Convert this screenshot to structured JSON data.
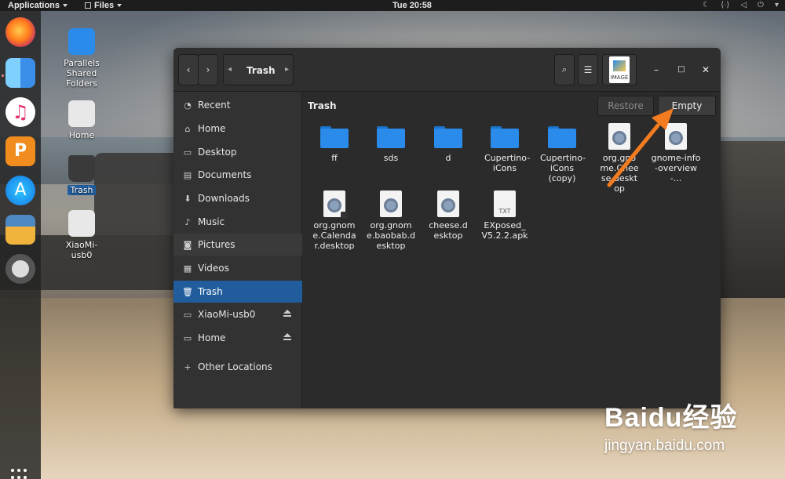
{
  "topbar": {
    "applications_label": "Applications",
    "files_label": "Files",
    "clock": "Tue 20:58"
  },
  "dock": {
    "items": [
      "firefox-icon",
      "finder-icon",
      "music-icon",
      "presentation-icon",
      "app-store-icon",
      "installer-icon",
      "lifebuoy-icon"
    ]
  },
  "desktop": {
    "icons": [
      {
        "label": "Parallels Shared Folders"
      },
      {
        "label": "Home"
      },
      {
        "label": "Trash"
      },
      {
        "label": "XiaoMi-usb0"
      }
    ]
  },
  "window": {
    "breadcrumb": "Trash",
    "view_thumb_label": "IMAGE"
  },
  "sidebar": {
    "items": [
      {
        "label": "Recent",
        "icon": "clock-icon"
      },
      {
        "label": "Home",
        "icon": "home-icon"
      },
      {
        "label": "Desktop",
        "icon": "desktop-icon"
      },
      {
        "label": "Documents",
        "icon": "document-icon"
      },
      {
        "label": "Downloads",
        "icon": "download-icon"
      },
      {
        "label": "Music",
        "icon": "music-note-icon"
      },
      {
        "label": "Pictures",
        "icon": "camera-icon"
      },
      {
        "label": "Videos",
        "icon": "film-icon"
      },
      {
        "label": "Trash",
        "icon": "trash-icon"
      },
      {
        "label": "XiaoMi-usb0",
        "icon": "drive-icon"
      },
      {
        "label": "Home",
        "icon": "drive-icon"
      },
      {
        "label": "Other Locations",
        "icon": "plus-icon"
      }
    ],
    "active_item": "Trash"
  },
  "main": {
    "title": "Trash",
    "restore_label": "Restore",
    "empty_label": "Empty",
    "files": [
      {
        "name": "ff",
        "type": "folder"
      },
      {
        "name": "sds",
        "type": "folder"
      },
      {
        "name": "d",
        "type": "folder"
      },
      {
        "name": "Cupertino-iCons",
        "type": "folder"
      },
      {
        "name": "Cupertino-iCons (copy)",
        "type": "folder"
      },
      {
        "name": "org.gnome.Cheese.desktop",
        "type": "desktop"
      },
      {
        "name": "gnome-info-overview-...",
        "type": "desktop"
      },
      {
        "name": "org.gnome.Calendar.desktop",
        "type": "desktop"
      },
      {
        "name": "org.gnome.baobab.desktop",
        "type": "desktop"
      },
      {
        "name": "cheese.desktop",
        "type": "desktop"
      },
      {
        "name": "EXposed_V5.2.2.apk",
        "type": "text"
      }
    ],
    "text_file_badge": "TXT"
  },
  "watermark": {
    "brand": "Baidu经验",
    "url": "jingyan.baidu.com"
  },
  "colors": {
    "accent": "#215d9c",
    "folder": "#2a8bea",
    "arrow": "#f47c20"
  }
}
